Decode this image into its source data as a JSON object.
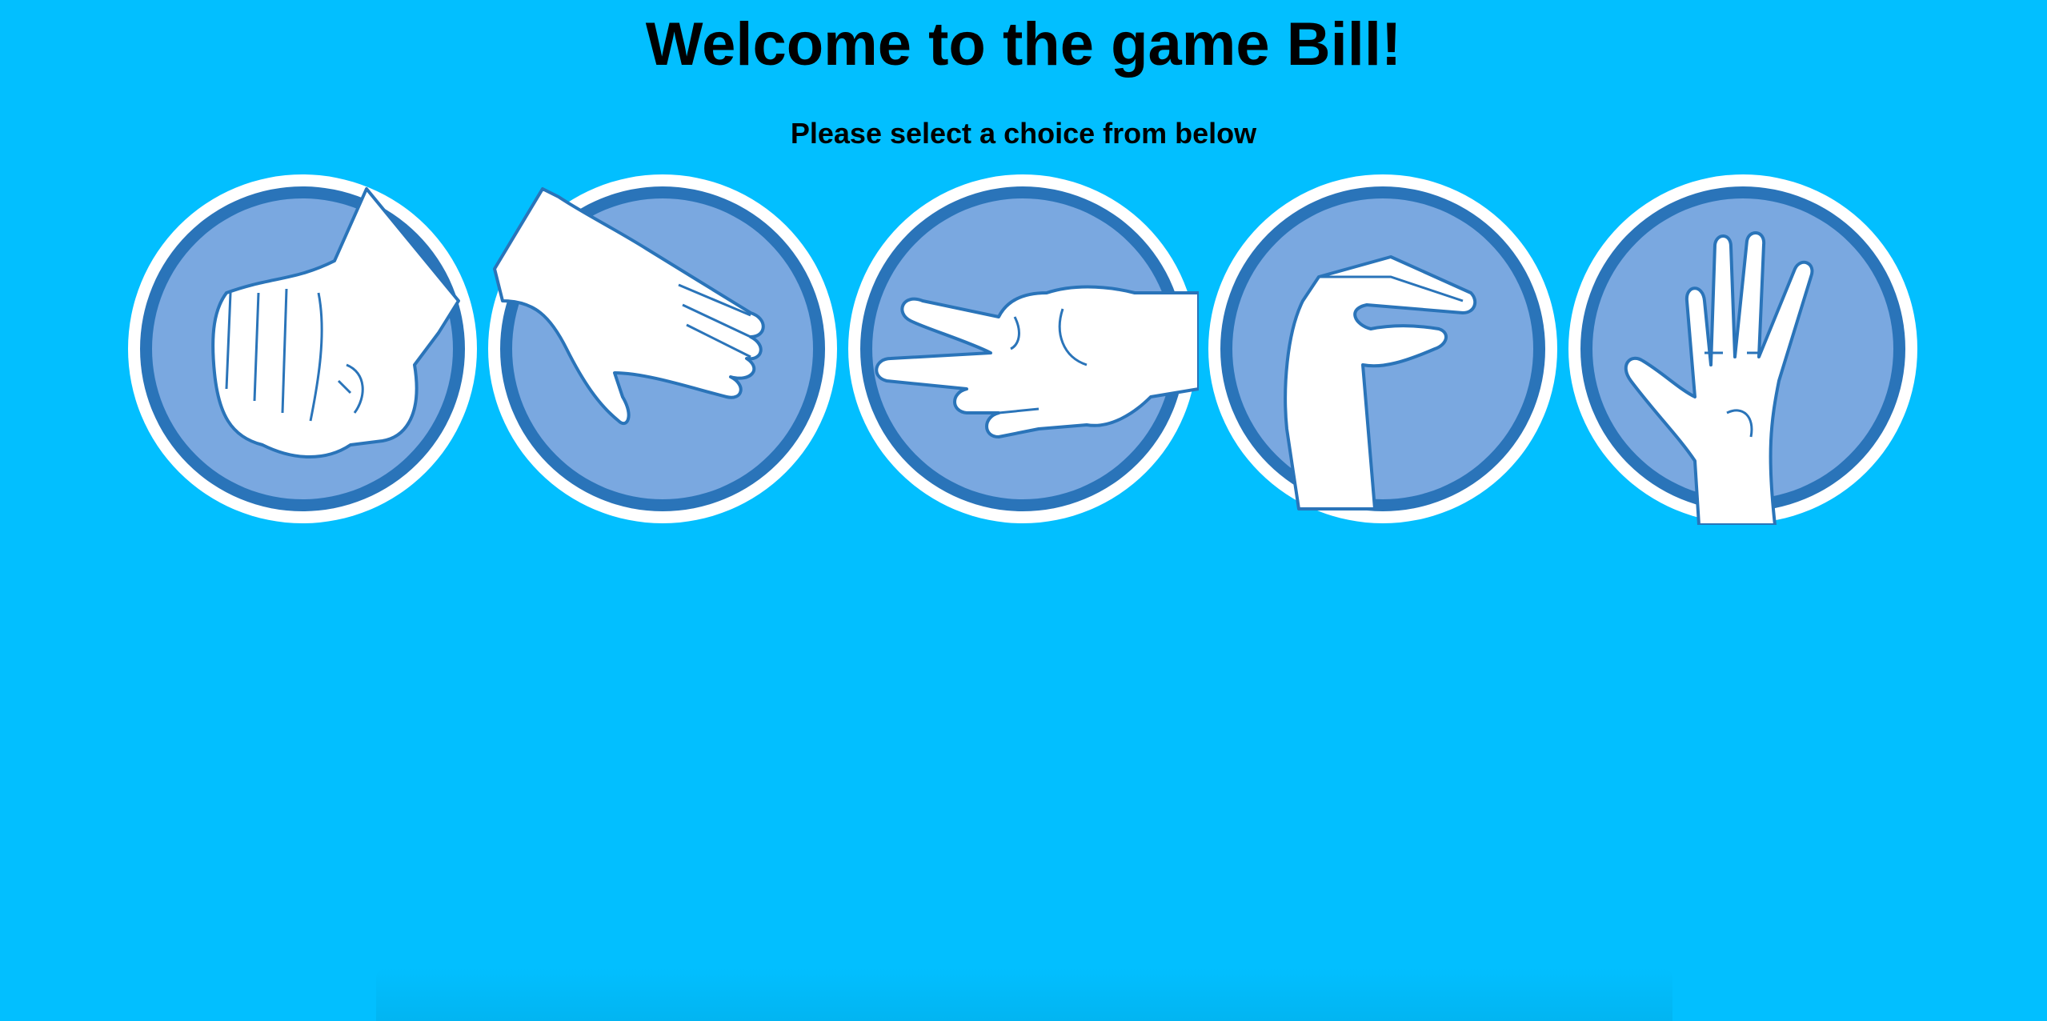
{
  "header": {
    "title": "Welcome to the game Bill!",
    "subtitle": "Please select a choice from below"
  },
  "choices": [
    {
      "id": "rock",
      "icon": "rock-fist-icon"
    },
    {
      "id": "paper",
      "icon": "paper-hand-icon"
    },
    {
      "id": "scissors",
      "icon": "scissors-hand-icon"
    },
    {
      "id": "lizard",
      "icon": "lizard-hand-icon"
    },
    {
      "id": "spock",
      "icon": "spock-hand-icon"
    }
  ],
  "colors": {
    "background": "#02bfff",
    "ring_outer": "#ffffff",
    "ring_inner": "#2a74b9",
    "disc": "#7aa8e0",
    "hand": "#ffffff",
    "hand_stroke": "#2a74b9"
  }
}
